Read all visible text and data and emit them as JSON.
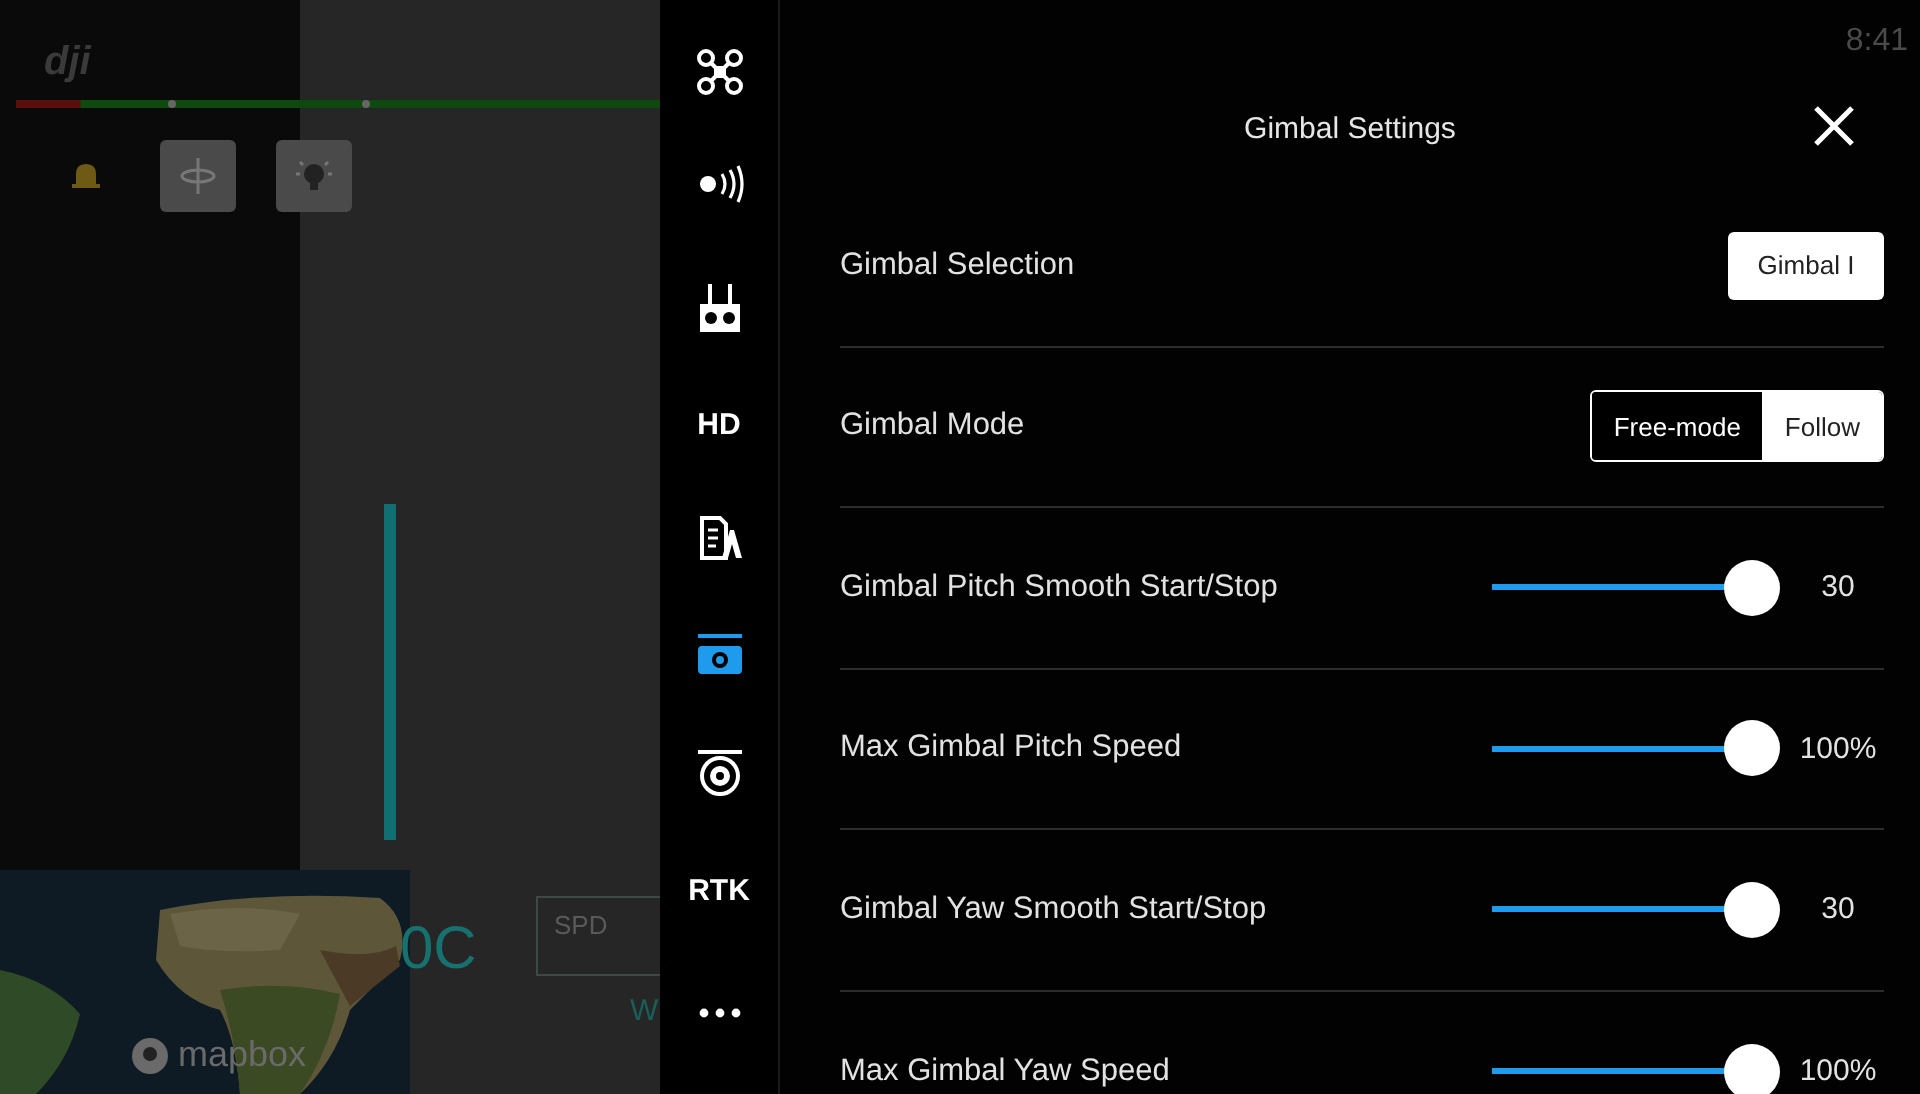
{
  "flight_view": {
    "logo": "dji",
    "limit_bar": {
      "level": 0.9
    },
    "speed_box": {
      "label": "SPD"
    },
    "reading": "0C",
    "heading_letter": "W",
    "map": {
      "kind": "picture",
      "attribution": "mapbox"
    }
  },
  "status_bar": {
    "time": "8:41"
  },
  "sidebar": {
    "items": [
      {
        "kind": "aircraft",
        "selected": false
      },
      {
        "kind": "signal",
        "selected": false
      },
      {
        "kind": "remote",
        "selected": false
      },
      {
        "kind": "text",
        "label": "HD",
        "selected": false
      },
      {
        "kind": "document",
        "selected": false
      },
      {
        "kind": "camera",
        "selected": true
      },
      {
        "kind": "gimbal",
        "selected": false
      },
      {
        "kind": "text",
        "label": "RTK",
        "selected": false
      },
      {
        "kind": "more",
        "selected": false
      }
    ]
  },
  "panel": {
    "title": "Gimbal Settings",
    "rows": [
      {
        "kind": "button",
        "label": "Gimbal Selection",
        "button": "Gimbal I"
      },
      {
        "kind": "segmented",
        "label": "Gimbal Mode",
        "options": [
          {
            "label": "Free-mode",
            "selected": false
          },
          {
            "label": "Follow",
            "selected": true
          }
        ]
      },
      {
        "kind": "slider",
        "label": "Gimbal Pitch Smooth Start/Stop",
        "level": 1,
        "reading": "30"
      },
      {
        "kind": "slider",
        "label": "Max Gimbal Pitch Speed",
        "level": 1,
        "reading": "100%"
      },
      {
        "kind": "slider",
        "label": "Gimbal Yaw Smooth Start/Stop",
        "level": 1,
        "reading": "30"
      },
      {
        "kind": "slider",
        "label": "Max Gimbal Yaw Speed",
        "level": 1,
        "reading": "100%"
      }
    ]
  }
}
